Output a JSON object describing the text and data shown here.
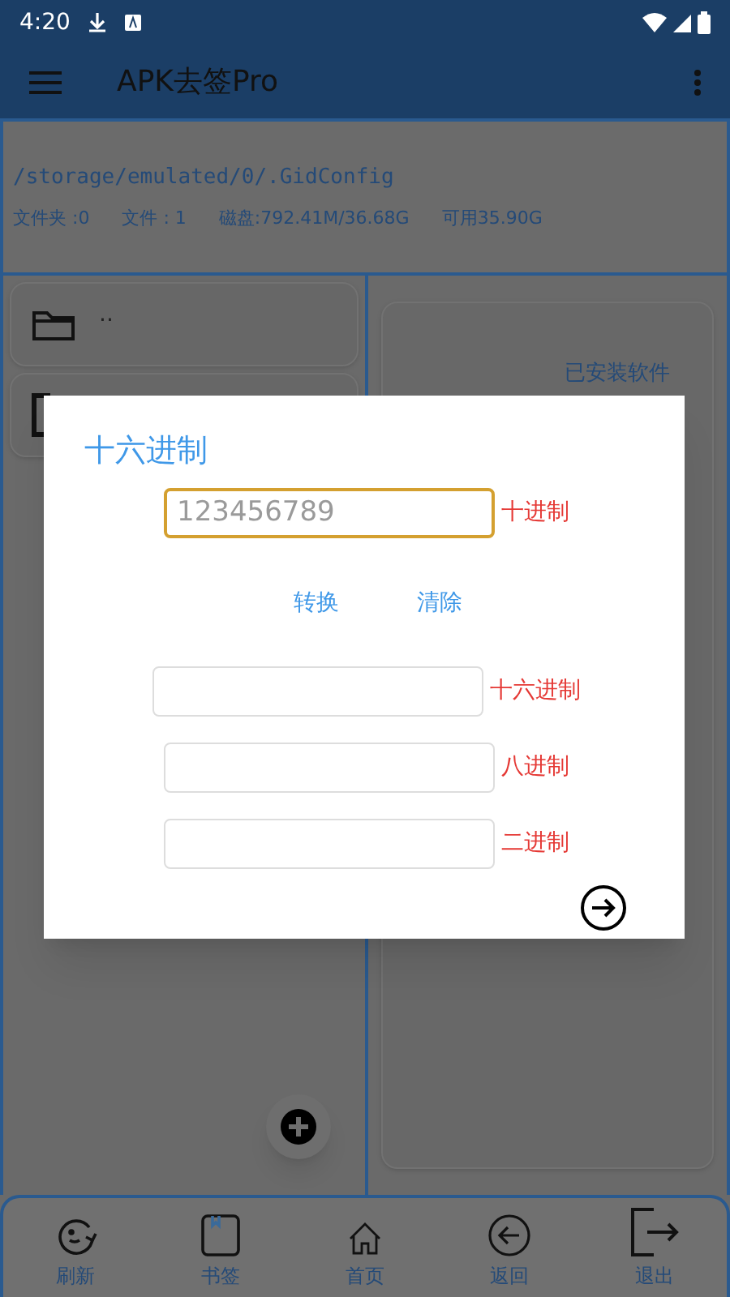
{
  "status_bar": {
    "time": "4:20"
  },
  "app_bar": {
    "title": "APK去签Pro"
  },
  "path_panel": {
    "path": "/storage/emulated/0/.GidConfig",
    "stats": [
      "文件夹 :0",
      "文件 : 1",
      "磁盘:792.41M/36.68G",
      "可用35.90G"
    ]
  },
  "file_list": [
    {
      "kind": "folder",
      "name": ".."
    },
    {
      "kind": "file"
    }
  ],
  "side_panel": {
    "title": "已安装软件"
  },
  "dialog": {
    "title": "十六进制",
    "input": {
      "placeholder": "123456789",
      "label": "十进制",
      "focused": true
    },
    "buttons": [
      "转换",
      "清除"
    ],
    "outputs": [
      {
        "label": "十六进制"
      },
      {
        "label": "八进制"
      },
      {
        "label": "二进制"
      }
    ]
  },
  "bottom_nav": [
    {
      "label": "刷新",
      "kind": "refresh"
    },
    {
      "label": "书签",
      "kind": "bookmark"
    },
    {
      "label": "首页",
      "kind": "home"
    },
    {
      "label": "返回",
      "kind": "back"
    },
    {
      "label": "退出",
      "kind": "exit"
    }
  ]
}
